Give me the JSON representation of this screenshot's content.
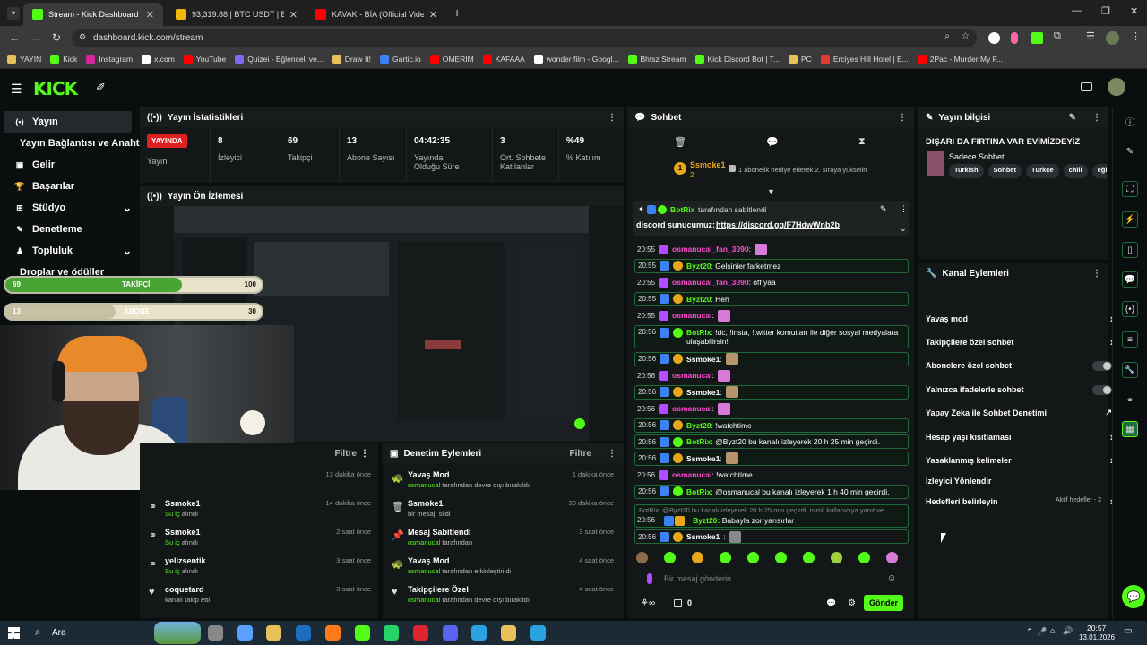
{
  "browser": {
    "tabs": [
      {
        "title": "Stream - Kick Dashboard",
        "active": true,
        "color": "#53fc18"
      },
      {
        "title": "93,319.88 | BTC USDT | Bitcoin t",
        "active": false,
        "color": "#f0b90b"
      },
      {
        "title": "KAVAK - BİA (Official Video)",
        "active": false,
        "color": "#ff0000"
      }
    ],
    "url": "dashboard.kick.com/stream",
    "bookmarks": [
      {
        "label": "YAYIN",
        "color": "#e8c15a"
      },
      {
        "label": "Kick",
        "color": "#53fc18"
      },
      {
        "label": "Instagram",
        "color": "#d6249f"
      },
      {
        "label": "x.com",
        "color": "#ffffff"
      },
      {
        "label": "YouTube",
        "color": "#ff0000"
      },
      {
        "label": "Quizei - Eğlenceli ve...",
        "color": "#7a6cf0"
      },
      {
        "label": "Draw It!",
        "color": "#e8c15a"
      },
      {
        "label": "Gartic.io",
        "color": "#3b82f6"
      },
      {
        "label": "ÖMERİM",
        "color": "#ff0000"
      },
      {
        "label": "KAFAAA",
        "color": "#ff0000"
      },
      {
        "label": "wonder film - Googl...",
        "color": "#ffffff"
      },
      {
        "label": "Bhtsz Stream",
        "color": "#53fc18"
      },
      {
        "label": "Kick Discord Bot | T...",
        "color": "#53fc18"
      },
      {
        "label": "PC",
        "color": "#e8c15a"
      },
      {
        "label": "Erciyes Hill Hotel | E...",
        "color": "#e53935"
      },
      {
        "label": "2Pac - Murder My F...",
        "color": "#ff0000"
      }
    ]
  },
  "app": {
    "logo": "KICK",
    "logo_color": "#53fc18"
  },
  "sidebar": {
    "items": [
      {
        "label": "Yayın",
        "icon": "broadcast-icon",
        "glyph": "(•)",
        "active": true
      },
      {
        "label": "Yayın Bağlantısı ve Anahtarı",
        "icon": "key-icon",
        "glyph": "",
        "active": false
      },
      {
        "label": "Gelir",
        "icon": "dollar-icon",
        "glyph": "▣",
        "active": false
      },
      {
        "label": "Başarılar",
        "icon": "trophy-icon",
        "glyph": "🏆",
        "active": false
      },
      {
        "label": "Stüdyo",
        "icon": "studio-icon",
        "glyph": "⊞",
        "active": false
      },
      {
        "label": "Denetleme",
        "icon": "wrench-icon",
        "glyph": "✎",
        "active": false
      },
      {
        "label": "Topluluk",
        "icon": "community-icon",
        "glyph": "♟",
        "active": false
      },
      {
        "label": "Droplar ve ödüller",
        "icon": "gift-icon",
        "glyph": "",
        "active": false
      }
    ]
  },
  "stats": {
    "title": "Yayın İstatistikleri",
    "live_badge": "YAYINDA",
    "live_label": "Yayın",
    "items": [
      {
        "value": "8",
        "label": "İzleyici"
      },
      {
        "value": "69",
        "label": "Takipçi"
      },
      {
        "value": "13",
        "label": "Abone Sayısı"
      },
      {
        "value": "04:42:35",
        "label": "Yayında Olduğu Süre"
      },
      {
        "value": "3",
        "label": "Ort. Sohbete Katılanlar"
      },
      {
        "value": "%49",
        "label": "% Katılım"
      }
    ]
  },
  "preview": {
    "title": "Yayın Ön İzlemesi"
  },
  "overlay": {
    "followers": {
      "current": "69",
      "label": "TAKİPÇİ",
      "goal": "100",
      "progress": 0.69
    },
    "subs": {
      "current": "13",
      "label": "ABONE",
      "goal": "30",
      "progress": 0.43
    }
  },
  "activity": {
    "filter_label": "Filtre",
    "items": [
      {
        "name": "",
        "sub": "",
        "time": "13 dakika önce"
      },
      {
        "name": "Ssmoke1",
        "sub_green": "Su iç",
        "sub": "alındı",
        "time": "14 dakika önce"
      },
      {
        "name": "Ssmoke1",
        "sub_green": "Su iç",
        "sub": "alındı",
        "time": "2 saat önce"
      },
      {
        "name": "yelizsentik",
        "sub_green": "Su iç",
        "sub": "alındı",
        "time": "3 saat önce"
      },
      {
        "name": "coquetard",
        "sub_green": "",
        "sub": "kanalı takip etti",
        "time": "3 saat önce"
      }
    ]
  },
  "mod_actions": {
    "title": "Denetim Eylemleri",
    "filter_label": "Filtre",
    "items": [
      {
        "icon": "slow-mode-icon",
        "glyph": "🐢",
        "name": "Yavaş Mod",
        "user": "osmanucal",
        "sub": "tarafından devre dışı bırakıldı",
        "time": "1 dakika önce"
      },
      {
        "icon": "trash-icon",
        "glyph": "🗑",
        "name": "Ssmoke1",
        "user": "",
        "sub": "bir mesajı sildi",
        "time": "30 dakika önce"
      },
      {
        "icon": "pin-icon",
        "glyph": "📌",
        "name": "Mesaj Sabitlendi",
        "user": "osmanucal",
        "sub": "tarafından",
        "time": "3 saat önce"
      },
      {
        "icon": "slow-mode-icon",
        "glyph": "🐢",
        "name": "Yavaş Mod",
        "user": "osmanucal",
        "sub": "tarafından etkinleştirildi",
        "time": "4 saat önce"
      },
      {
        "icon": "heart-icon",
        "glyph": "♥",
        "name": "Takipçilere Özel",
        "user": "osmanucal",
        "sub": "tarafından devre dışı bırakıldı",
        "time": "4 saat önce"
      }
    ]
  },
  "chat": {
    "title": "Sohbet",
    "top_gifter": {
      "name": "Ssmoke1",
      "count": "2",
      "rank": "1",
      "message": "1 abonelik hediye ederek 2. sıraya yükselin"
    },
    "pinned": {
      "by": "BotRix",
      "by_suffix": "tarafından sabitlendi",
      "text_prefix": "discord sunucumuz:",
      "link": "https://discord.gg/F7HdwWnb2b"
    },
    "lines": [
      {
        "time": "20:55",
        "user": "osmanucal_fan_3090",
        "ucolor": "#ff4dd2",
        "text": ":",
        "emote": true,
        "hl": false
      },
      {
        "time": "20:55",
        "user": "Byzt20",
        "ucolor": "#53fc18",
        "text": ": Gelsinler farketmez",
        "emote": false,
        "hl": true
      },
      {
        "time": "20:55",
        "user": "osmanucal_fan_3090",
        "ucolor": "#ff4dd2",
        "text": ": off yaa",
        "emote": false,
        "hl": false
      },
      {
        "time": "20:55",
        "user": "Byzt20",
        "ucolor": "#53fc18",
        "text": ": Heh",
        "emote": false,
        "hl": true
      },
      {
        "time": "20:55",
        "user": "osmanucal",
        "ucolor": "#ff4dd2",
        "text": ":",
        "emote": true,
        "hl": false
      },
      {
        "time": "20:56",
        "user": "BotRix",
        "ucolor": "#53fc18",
        "text": ": !dc, !insta, !twitter komutları ile diğer sosyal medyalara ulaşabilirsin!",
        "emote": false,
        "hl": true
      },
      {
        "time": "20:56",
        "user": "Ssmoke1",
        "ucolor": "#ffffff",
        "text": ":",
        "emote": true,
        "hl": true
      },
      {
        "time": "20:56",
        "user": "osmanucal",
        "ucolor": "#ff4dd2",
        "text": ":",
        "emote": true,
        "hl": false
      },
      {
        "time": "20:56",
        "user": "Ssmoke1",
        "ucolor": "#ffffff",
        "text": ":",
        "emote": true,
        "hl": true
      },
      {
        "time": "20:56",
        "user": "osmanucal",
        "ucolor": "#ff4dd2",
        "text": ":",
        "emote": true,
        "hl": false
      },
      {
        "time": "20:56",
        "user": "Byzt20",
        "ucolor": "#53fc18",
        "text": ": !watchtime",
        "emote": false,
        "hl": true
      },
      {
        "time": "20:56",
        "user": "BotRix",
        "ucolor": "#53fc18",
        "text": ": @Byzt20 bu kanalı izleyerek 20 h 25 min geçirdi.",
        "emote": false,
        "hl": true
      },
      {
        "time": "20:56",
        "user": "Ssmoke1",
        "ucolor": "#ffffff",
        "text": ":",
        "emote": true,
        "hl": true
      },
      {
        "time": "20:56",
        "user": "osmanucal",
        "ucolor": "#ff4dd2",
        "text": ": !watchtime",
        "emote": false,
        "hl": false
      },
      {
        "time": "20:56",
        "user": "BotRix",
        "ucolor": "#53fc18",
        "text": ": @osmanucal bu kanalı izleyerek 1 h 40 min geçirdi.",
        "emote": false,
        "hl": true
      }
    ],
    "reply_quote": "BotRix: @Byzt20 bu kanalı izleyerek 20 h 25 min geçirdi. isimli kullanıcıya yanıt ve...",
    "reply_line": {
      "time": "20:56",
      "user": "Byzt20",
      "text": ": Babayla zor yarısırlar"
    },
    "last_line": {
      "time": "20:56",
      "user": "Ssmoke1",
      "text": ":"
    },
    "input_placeholder": "Bir mesaj gönderin",
    "points": "0",
    "send_label": "Gönder"
  },
  "stream_info": {
    "title": "Yayın bilgisi",
    "stream_title": "DIŞARI DA FIRTINA VAR EVİMİZDEYİZ",
    "category": "Sadece Sohbet",
    "tags": [
      "Turkish",
      "Sohbet",
      "Türkçe",
      "chill",
      "eğlen"
    ]
  },
  "channel_actions": {
    "title": "Kanal Eylemleri",
    "items": [
      {
        "label": "Yavaş mod",
        "control": "chevron"
      },
      {
        "label": "Takipçilere özel sohbet",
        "control": "chevron"
      },
      {
        "label": "Abonelere özel sohbet",
        "control": "toggle"
      },
      {
        "label": "Yalnızca ifadelerle sohbet",
        "control": "toggle"
      },
      {
        "label": "Yapay Zeka ile Sohbet Denetimi",
        "control": "external"
      },
      {
        "label": "Hesap yaşı kısıtlaması",
        "control": "chevron"
      },
      {
        "label": "Yasaklanmış kelimeler",
        "control": "chevron"
      },
      {
        "label": "İzleyici Yönlendir",
        "control": "none"
      },
      {
        "label": "Hedefleri belirleyin",
        "control": "chevron",
        "note": "Aktif hedefler - 2"
      }
    ]
  },
  "taskbar": {
    "search_label": "Ara",
    "time": "20:57",
    "date": "13.01.2026"
  }
}
